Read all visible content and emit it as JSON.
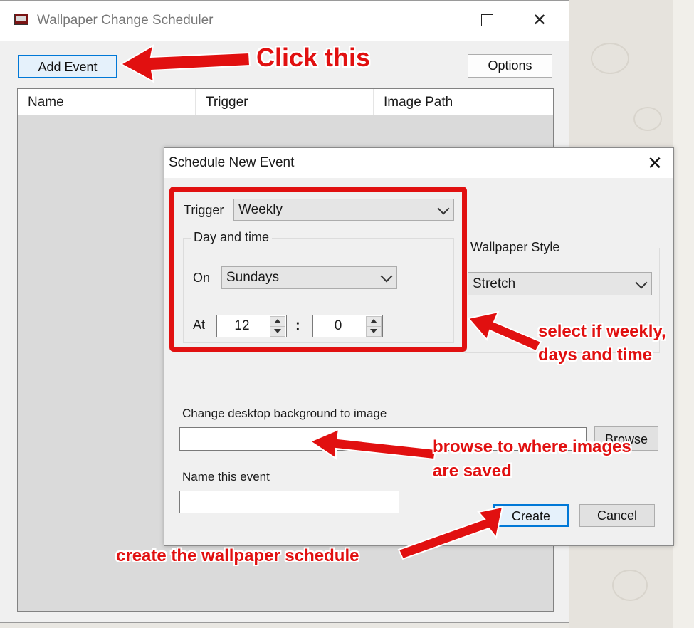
{
  "main_window": {
    "title": "Wallpaper Change Scheduler",
    "minimize_glyph": "",
    "maximize_glyph": "",
    "close_glyph": "✕",
    "add_event_label": "Add Event",
    "options_label": "Options",
    "columns": [
      "Name",
      "Trigger",
      "Image Path"
    ]
  },
  "dialog": {
    "title": "Schedule New Event",
    "close_glyph": "✕",
    "trigger_label": "Trigger",
    "trigger_value": "Weekly",
    "day_time_group": "Day and time",
    "on_label": "On",
    "on_value": "Sundays",
    "at_label": "At",
    "hour_value": "12",
    "time_separator": ":",
    "minute_value": "0",
    "wallpaper_style_group": "Wallpaper Style",
    "wallpaper_style_value": "Stretch",
    "image_label": "Change desktop background to image",
    "image_value": "",
    "browse_label": "Browse",
    "name_label": "Name this event",
    "name_value": "",
    "create_label": "Create",
    "cancel_label": "Cancel"
  },
  "annotations": {
    "click_this": "Click this",
    "weekly_line1": "select if weekly,",
    "weekly_line2": "days and time",
    "browse_line1": "browse to where images",
    "browse_line2": "are saved",
    "create_note": "create the wallpaper schedule"
  },
  "colors": {
    "annotation_red": "#e11010",
    "focus_blue": "#0078d7"
  }
}
